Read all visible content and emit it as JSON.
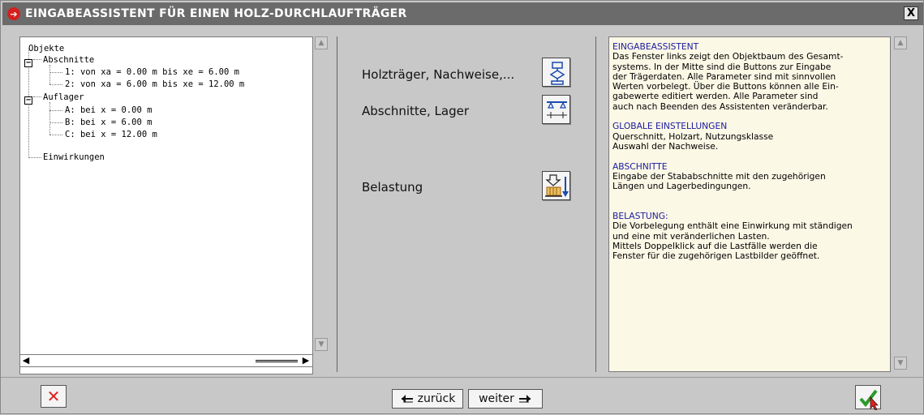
{
  "window": {
    "title": "EINGABEASSISTENT FÜR EINEN HOLZ-DURCHLAUFTRÄGER",
    "close_label": "X"
  },
  "tree": {
    "root": "Objekte",
    "abschnitte_label": "Abschnitte",
    "abschnitte": [
      "1: von xa = 0.00 m bis xe = 6.00 m",
      "2: von xa = 6.00 m bis xe = 12.00 m"
    ],
    "auflager_label": "Auflager",
    "auflager": [
      "A: bei x = 0.00 m",
      "B: bei x = 6.00 m",
      "C: bei x = 12.00 m"
    ],
    "einwirkungen_label": "Einwirkungen",
    "expander_symbol": "−"
  },
  "middle": {
    "items": [
      {
        "label": "Holzträger, Nachweise,...",
        "icon": "flowchart-icon"
      },
      {
        "label": "Abschnitte, Lager",
        "icon": "beam-supports-icon"
      },
      {
        "label": "Belastung",
        "icon": "load-icon"
      }
    ]
  },
  "info": {
    "sections": [
      {
        "heading": "EINGABEASSISTENT",
        "body": "Das Fenster links zeigt den Objektbaum des Gesamt-\nsystems. In der Mitte sind die Buttons zur Eingabe\nder Trägerdaten. Alle Parameter sind mit sinnvollen\nWerten vorbelegt. Über die Buttons können alle Ein-\ngabewerte editiert werden. Alle Parameter sind\nauch nach Beenden des Assistenten veränderbar."
      },
      {
        "heading": "GLOBALE EINSTELLUNGEN",
        "body": "Querschnitt, Holzart, Nutzungsklasse\nAuswahl der Nachweise."
      },
      {
        "heading": "ABSCHNITTE",
        "body": "Eingabe der Stababschnitte mit den zugehörigen\nLängen und Lagerbedingungen."
      },
      {
        "heading": "BELASTUNG:",
        "body": "Die Vorbelegung enthält eine Einwirkung mit ständigen\nund eine mit veränderlichen Lasten.\nMittels Doppelklick auf die Lastfälle werden die\nFenster für die zugehörigen Lastbilder geöffnet."
      }
    ]
  },
  "footer": {
    "back_label": "zurück",
    "next_label": "weiter"
  },
  "colors": {
    "title_bar": "#6b6b6b",
    "info_bg": "#fcf8e6",
    "heading": "#1a1aa0",
    "cancel": "#e02020",
    "ok_check": "#2a9a2a"
  }
}
